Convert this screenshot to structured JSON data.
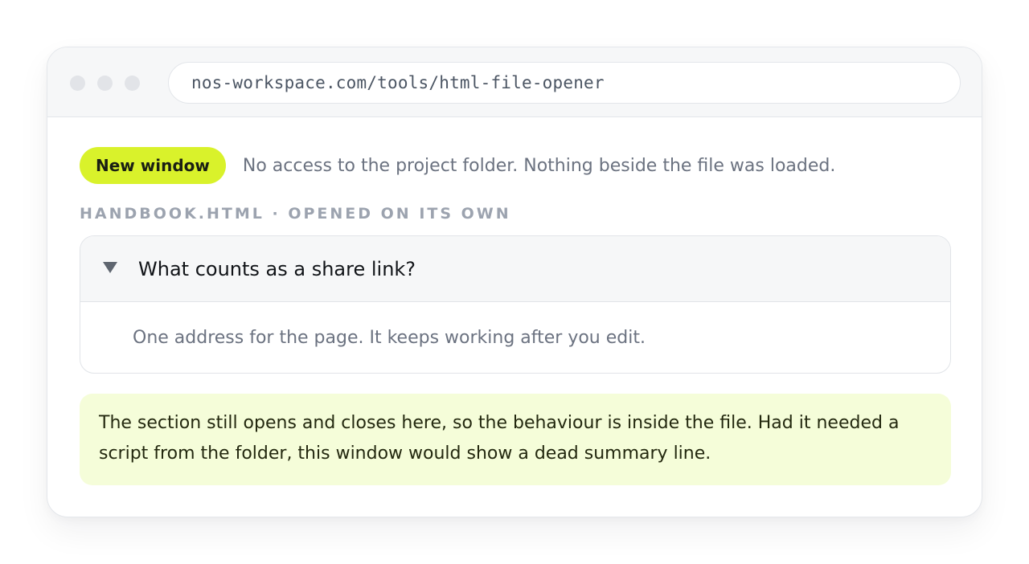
{
  "browser": {
    "url": "nos-workspace.com/tools/html-file-opener"
  },
  "status": {
    "badge": "New window",
    "message": "No access to the project folder. Nothing beside the file was loaded."
  },
  "file_label": "HANDBOOK.HTML · OPENED ON ITS OWN",
  "disclosure": {
    "summary": "What counts as a share link?",
    "answer": "One address for the page. It keeps working after you edit.",
    "expanded": true
  },
  "note": {
    "text": "The section still opens and closes here, so the behaviour is inside the file. Had it needed a script from the folder, this window would show a dead summary line."
  },
  "colors": {
    "badge_bg": "#d9f22b",
    "note_bg": "#f5fdd9",
    "summary_bg": "#f6f7f8"
  }
}
